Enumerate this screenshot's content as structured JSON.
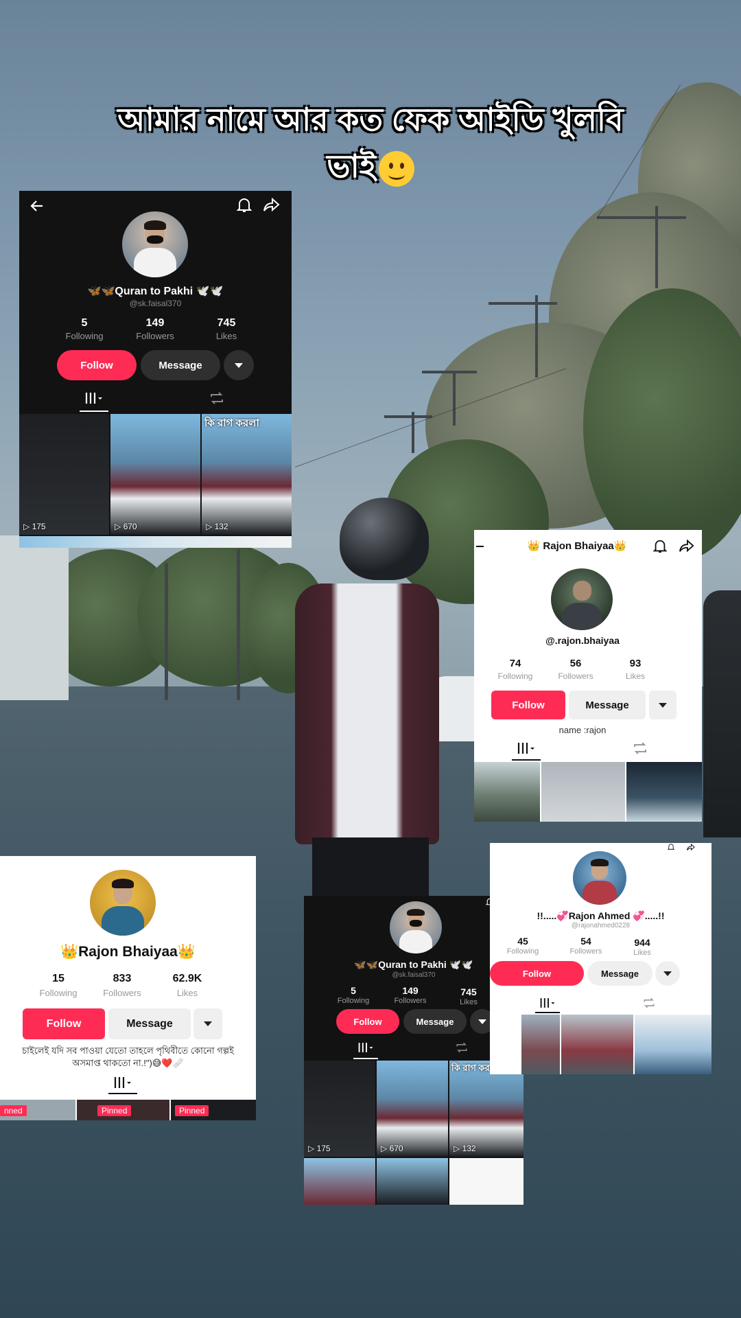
{
  "caption": {
    "line1": "আমার নামে আর কত ফেক আইডি খুলবি",
    "line2": "ভাই"
  },
  "cards": {
    "quran_top": {
      "name": "🦋🦋Quran to Pakhi 🕊️🕊️",
      "handle": "@sk.faisal370",
      "following": "5",
      "following_label": "Following",
      "followers": "149",
      "followers_label": "Followers",
      "likes": "745",
      "likes_label": "Likes",
      "follow_label": "Follow",
      "message_label": "Message",
      "thumbs": [
        {
          "views": "175"
        },
        {
          "views": "670"
        },
        {
          "views": "132",
          "overlay": "কি রাগ করলা"
        }
      ]
    },
    "rajon_right": {
      "title": "👑 Rajon Bhaiyaa👑",
      "handle": "@.rajon.bhaiyaa",
      "following": "74",
      "following_label": "Following",
      "followers": "56",
      "followers_label": "Followers",
      "likes": "93",
      "likes_label": "Likes",
      "follow_label": "Follow",
      "message_label": "Message",
      "bio": "name :rajon"
    },
    "rajon_left": {
      "name": "👑Rajon Bhaiyaa👑",
      "following": "15",
      "following_label": "Following",
      "followers": "833",
      "followers_label": "Followers",
      "likes": "62.9K",
      "likes_label": "Likes",
      "follow_label": "Follow",
      "message_label": "Message",
      "bio": "চাইলেই যদি সব পাওয়া যেতো তাহলে পৃথিবীতে কোনো গল্পই অসমাপ্ত থাকতো না.!\")😅❤️🩹",
      "pinned_labels": [
        "nned",
        "Pinned",
        "Pinned"
      ]
    },
    "quran_bottom": {
      "name": "🦋🦋Quran to Pakhi 🕊️🕊️",
      "handle": "@sk.faisal370",
      "following": "5",
      "following_label": "Following",
      "followers": "149",
      "followers_label": "Followers",
      "likes": "745",
      "likes_label": "Likes",
      "follow_label": "Follow",
      "message_label": "Message",
      "thumbs": [
        {
          "views": "175"
        },
        {
          "views": "670"
        },
        {
          "views": "132",
          "overlay": "কি রাগ করলা"
        }
      ]
    },
    "rajon_ahmed": {
      "name": "!!.....💞Rajon Ahmed 💞.....!!",
      "handle": "@rajonahmed0228",
      "following": "45",
      "following_label": "Following",
      "followers": "54",
      "followers_label": "Followers",
      "likes": "944",
      "likes_label": "Likes",
      "follow_label": "Follow",
      "message_label": "Message"
    }
  },
  "colors": {
    "follow": "#fe2c55",
    "dark_card": "#121212",
    "light_card": "#ffffff"
  }
}
